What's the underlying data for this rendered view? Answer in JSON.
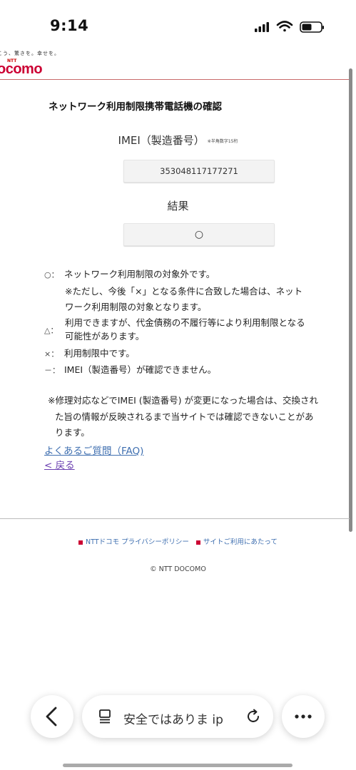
{
  "status_bar": {
    "time": "9:14"
  },
  "header": {
    "tagline": "こう、驚きを。幸せを。",
    "ntt_mark": "NTT",
    "logo_text": "ocomo"
  },
  "page": {
    "title": "ネットワーク利用制限携帯電話機の確認",
    "imei_label": "IMEI（製造番号）",
    "imei_note": "※半角数字15桁",
    "imei_value": "353048117177271",
    "result_label": "結果",
    "result_value": "○"
  },
  "legend": [
    {
      "symbol": "○：",
      "text": "ネットワーク利用制限の対象外です。"
    },
    {
      "symbol": "",
      "text": "※ただし、今後「×」となる条件に合致した場合は、ネット"
    },
    {
      "symbol": "",
      "text": "ワーク利用制限の対象となります。"
    },
    {
      "symbol": "△：",
      "text": "利用できますが、代金債務の不履行等により利用制限となる"
    },
    {
      "symbol": "",
      "text": "可能性があります。"
    },
    {
      "symbol": "×：",
      "text": "利用制限中です。"
    },
    {
      "symbol": "－：",
      "text": "IMEI（製造番号）が確認できません。"
    }
  ],
  "footnote": {
    "line1": "※修理対応などでIMEI (製造番号) が変更になった場合は、交換され",
    "line2": "た旨の情報が反映されるまで当サイトでは確認できないことがあ",
    "line3": "ります。"
  },
  "links": {
    "faq": "よくあるご質問（FAQ)",
    "back": "< 戻る"
  },
  "footer": {
    "privacy": "NTTドコモ プライバシーポリシー",
    "terms": "サイトご利用にあたって",
    "copyright": "© NTT DOCOMO"
  },
  "browser": {
    "url_text": "安全ではありま    ip"
  },
  "colors": {
    "brand_red": "#cc0033",
    "link_blue": "#3f6fb0",
    "visited_purple": "#6a3fb0"
  }
}
